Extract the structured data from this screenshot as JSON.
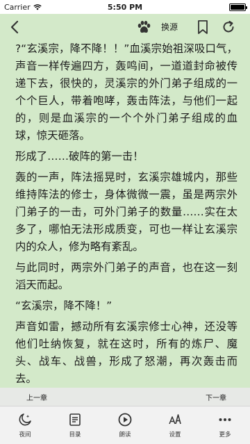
{
  "status_bar": {
    "carrier": "Carrier",
    "time": "5:50 PM"
  },
  "nav": {
    "switch_source": "换源",
    "icons": [
      "back-chevron-icon",
      "paw-icon",
      "bookmark-icon",
      "refresh-icon"
    ]
  },
  "reader": {
    "background_color": "#d3e9c9",
    "paragraphs": [
      "?“玄溪宗，降不降！！”血溪宗始祖深吸口气，声音一样传遍四方，轰鸣间，一道道封命被传递下去，很快的，灵溪宗的外门弟子组成的一个个巨人，带着咆哮，轰击阵法，与他们一起的，则是血溪宗的一个个外门弟子组成的血球，惊天砸落。",
      "形成了……破阵的第一击！",
      "轰的一声，阵法摇晃时，玄溪宗雄城内，那些维持阵法的修士，身体微微一震，虽是两宗外门弟子的一击，可外门弟子的数量……实在太多了，哪怕无法形成质变，可也一样让玄溪宗内的众人，修为略有紊乱。",
      "与此同时，两宗外门弟子的声音，也在这一刻滔天而起。",
      "“玄溪宗，降不降！”",
      "声音如雷，撼动所有玄溪宗修士心神，还没等他们吐纳恢复，就在这时，所有的炼尸、魔头、战车、战兽，形成了怒潮，再次轰击而去。"
    ]
  },
  "chapter_nav": {
    "prev": "上一章",
    "next": "下一章"
  },
  "tabs": [
    {
      "label": "夜间",
      "icon": "night-mode-icon"
    },
    {
      "label": "目录",
      "icon": "catalog-icon"
    },
    {
      "label": "朗读",
      "icon": "read-aloud-icon"
    },
    {
      "label": "设置",
      "icon": "settings-font-icon"
    },
    {
      "label": "更多",
      "icon": "more-icon"
    }
  ]
}
